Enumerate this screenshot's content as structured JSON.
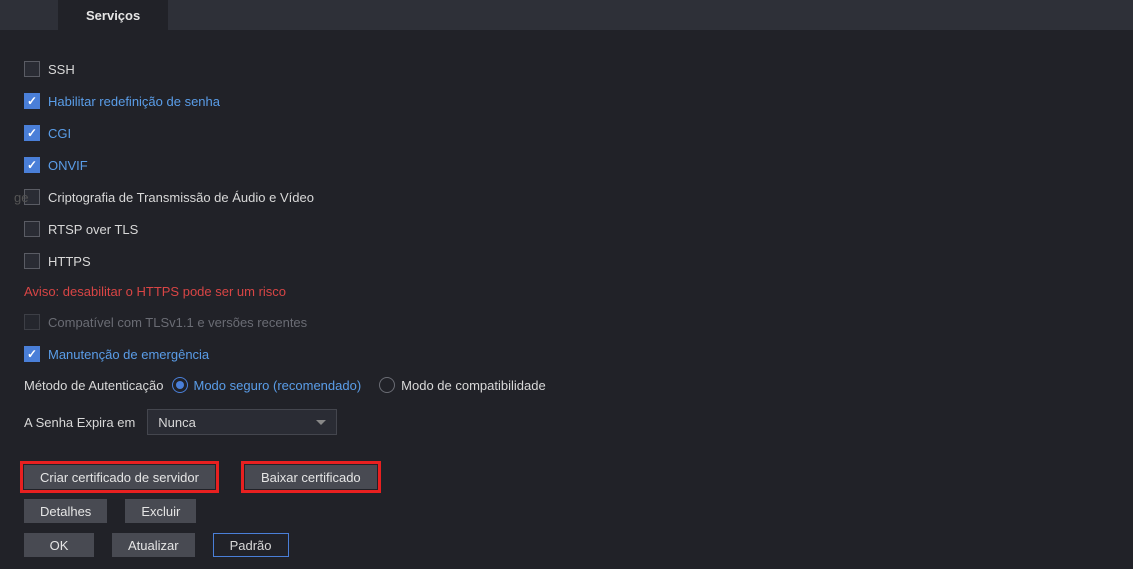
{
  "tab": {
    "title": "Serviços"
  },
  "ssh": {
    "label": "SSH",
    "checked": false
  },
  "password_reset": {
    "label": "Habilitar redefinição de senha",
    "checked": true
  },
  "cgi": {
    "label": "CGI",
    "checked": true
  },
  "onvif": {
    "label": "ONVIF",
    "checked": true
  },
  "crypto": {
    "label": "Criptografia de Transmissão de Áudio e Vídeo",
    "checked": false,
    "cutoff": "ge"
  },
  "rtsp_tls": {
    "label": "RTSP over TLS",
    "checked": false
  },
  "https": {
    "label": "HTTPS",
    "checked": false
  },
  "warning": "Aviso: desabilitar o HTTPS pode ser um risco",
  "tls_compat": {
    "label": "Compatível com TLSv1.1 e versões recentes",
    "checked": false,
    "disabled": true
  },
  "emergency": {
    "label": "Manutenção de emergência",
    "checked": true
  },
  "auth_method": {
    "label": "Método de Autenticação",
    "opt_secure": "Modo seguro (recomendado)",
    "opt_compat": "Modo de compatibilidade",
    "selected": "secure"
  },
  "password_expire": {
    "label": "A Senha Expira em",
    "value": "Nunca"
  },
  "buttons": {
    "create_cert": "Criar certificado de servidor",
    "download_cert": "Baixar certificado",
    "details": "Detalhes",
    "delete": "Excluir",
    "ok": "OK",
    "refresh": "Atualizar",
    "default": "Padrão"
  }
}
